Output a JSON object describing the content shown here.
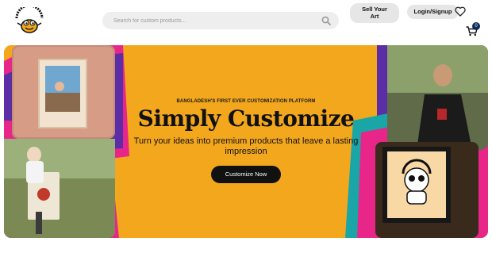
{
  "header": {
    "logo_text": "CUSTOMIZEEE",
    "search": {
      "placeholder": "Search for custom products...",
      "value": ""
    },
    "sell_label_line1": "Sell Your",
    "sell_label_line2": "Art",
    "login_label": "Login/Signup",
    "cart_count": "0"
  },
  "hero": {
    "tagline": "BANGLADESH'S FIRST EVER CUSTOMIZATION PLATFORM",
    "title": "Simply Customize",
    "subtitle": "Turn your ideas into premium products that leave a lasting impression",
    "cta_label": "Customize Now"
  },
  "colors": {
    "hero_bg": "#f3a71d",
    "accent_pink": "#e8268a",
    "accent_teal": "#1aa6a6",
    "accent_purple": "#5b2ea6",
    "cart_badge": "#0b2b5b"
  },
  "icons": {
    "search": "search-icon",
    "heart": "heart-icon",
    "cart": "cart-icon"
  }
}
